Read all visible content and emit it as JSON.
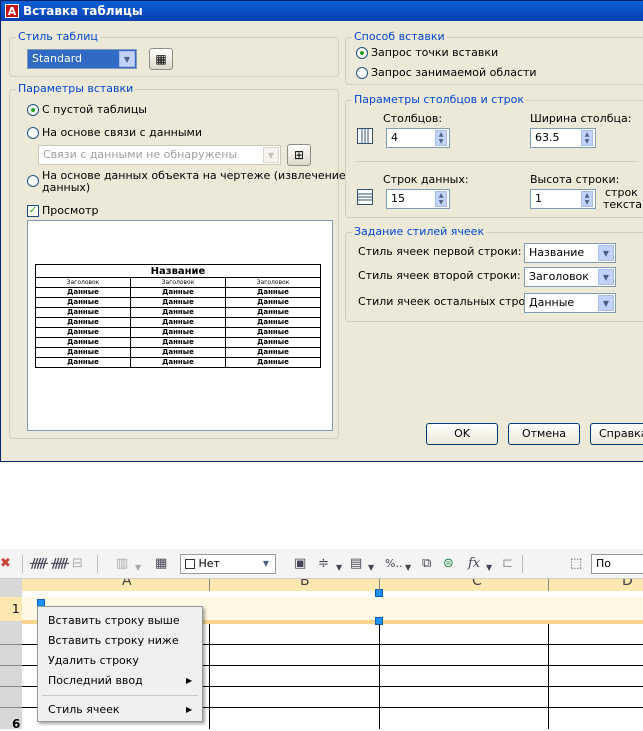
{
  "dialog": {
    "title": "Вставка таблицы",
    "table_style": {
      "legend": "Стиль таблиц",
      "value": "Standard"
    },
    "insert_options": {
      "legend": "Параметры вставки",
      "empty_table": "С пустой таблицы",
      "data_link": "На основе связи с данными",
      "data_link_combo": "Связи с данными не обнаружены",
      "extract_line1": "На основе данных объекта на чертеже (извлечение",
      "extract_line2": "данных)"
    },
    "preview": {
      "label": "Просмотр",
      "title": "Название",
      "headers": [
        "Заголовок",
        "Заголовок",
        "Заголовок"
      ],
      "cell": "Данные"
    },
    "insert_method": {
      "legend": "Способ вставки",
      "point": "Запрос точки вставки",
      "area": "Запрос занимаемой области"
    },
    "col_row": {
      "legend": "Параметры столбцов и строк",
      "columns_label": "Столбцов:",
      "columns_value": "4",
      "col_width_label": "Ширина столбца:",
      "col_width_value": "63.5",
      "rows_label": "Строк данных:",
      "rows_value": "15",
      "row_height_label": "Высота строки:",
      "row_height_value": "1",
      "row_height_unit_1": "строк",
      "row_height_unit_2": "текста"
    },
    "cell_styles": {
      "legend": "Задание стилей ячеек",
      "first_row_label": "Стиль ячеек первой строки:",
      "first_row_value": "Название",
      "second_row_label": "Стиль ячеек второй строки:",
      "second_row_value": "Заголовок",
      "other_rows_label": "Стили ячеек остальных строк:",
      "other_rows_value": "Данные"
    },
    "buttons": {
      "ok": "OK",
      "cancel": "Отмена",
      "help": "Справка"
    }
  },
  "toolbar": {
    "border_dropdown": "Нет",
    "percent_label": "%..",
    "fx_label": "fx",
    "by_row_dropdown": "По строке"
  },
  "sheet": {
    "column_headers": [
      "A",
      "B",
      "C",
      "D"
    ],
    "row_numbers": [
      "1",
      "6"
    ]
  },
  "context_menu": {
    "items": [
      {
        "label": "Вставить строку выше",
        "submenu": false
      },
      {
        "label": "Вставить строку ниже",
        "submenu": false
      },
      {
        "label": "Удалить строку",
        "submenu": false
      },
      {
        "label": "Последний ввод",
        "submenu": true
      },
      {
        "label": "Стиль ячеек",
        "submenu": true
      }
    ]
  }
}
